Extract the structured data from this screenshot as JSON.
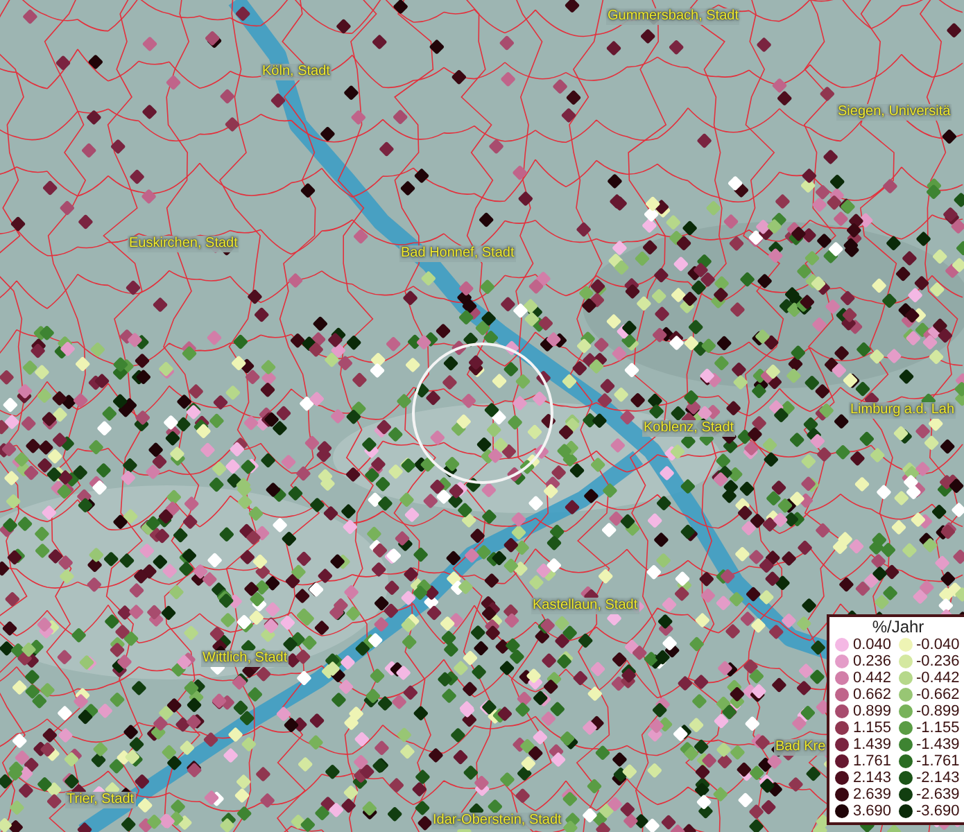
{
  "map": {
    "place_labels": [
      {
        "text": "Gummersbach, Stadt"
      },
      {
        "text": "Köln, Stadt"
      },
      {
        "text": "Siegen, Universitä"
      },
      {
        "text": "Euskirchen, Stadt"
      },
      {
        "text": "Bad Honnef, Stadt"
      },
      {
        "text": "Limburg a.d. Lah"
      },
      {
        "text": "Koblenz, Stadt"
      },
      {
        "text": "Kastellaun, Stadt"
      },
      {
        "text": "Wittlich, Stadt"
      },
      {
        "text": "Bad Kre"
      },
      {
        "text": "Trier, Stadt"
      },
      {
        "text": "Idar-Oberstein, Stadt"
      }
    ]
  },
  "legend": {
    "title": "%/Jahr",
    "items": [
      {
        "label": "0.040",
        "color": "#f4b8e4"
      },
      {
        "label": "-0.040",
        "color": "#eef4b4"
      },
      {
        "label": "0.236",
        "color": "#e49cc8"
      },
      {
        "label": "-0.236",
        "color": "#d4e8a0"
      },
      {
        "label": "0.442",
        "color": "#d27ea8"
      },
      {
        "label": "-0.442",
        "color": "#b6d88a"
      },
      {
        "label": "0.662",
        "color": "#c0648a"
      },
      {
        "label": "-0.662",
        "color": "#98c674"
      },
      {
        "label": "0.899",
        "color": "#a84c6e"
      },
      {
        "label": "-0.899",
        "color": "#78b25a"
      },
      {
        "label": "1.155",
        "color": "#903650"
      },
      {
        "label": "-1.155",
        "color": "#5a9c44"
      },
      {
        "label": "1.439",
        "color": "#7a2440"
      },
      {
        "label": "-1.439",
        "color": "#3e8432"
      },
      {
        "label": "1.761",
        "color": "#661830"
      },
      {
        "label": "-1.761",
        "color": "#2a6c22"
      },
      {
        "label": "2.143",
        "color": "#4e0e1e"
      },
      {
        "label": "-2.143",
        "color": "#1c5418"
      },
      {
        "label": "2.639",
        "color": "#3a0812"
      },
      {
        "label": "-2.639",
        "color": "#123e10"
      },
      {
        "label": "3.690",
        "color": "#200408"
      },
      {
        "label": "-3.690",
        "color": "#0a2a08"
      }
    ]
  }
}
